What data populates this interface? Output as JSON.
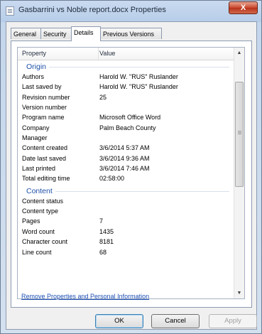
{
  "window": {
    "title": "Gasbarrini vs Noble report.docx Properties",
    "close_label": "X"
  },
  "tabs": [
    {
      "label": "General"
    },
    {
      "label": "Security"
    },
    {
      "label": "Details"
    },
    {
      "label": "Previous Versions"
    }
  ],
  "active_tab": "Details",
  "grid": {
    "header_property": "Property",
    "header_value": "Value",
    "groups": [
      {
        "label": "Origin",
        "rows": [
          {
            "property": "Authors",
            "value": "Harold W. \"RUS\" Ruslander"
          },
          {
            "property": "Last saved by",
            "value": "Harold W. \"RUS\" Ruslander"
          },
          {
            "property": "Revision number",
            "value": "25"
          },
          {
            "property": "Version number",
            "value": ""
          },
          {
            "property": "Program name",
            "value": "Microsoft Office Word"
          },
          {
            "property": "Company",
            "value": "Palm Beach County"
          },
          {
            "property": "Manager",
            "value": ""
          },
          {
            "property": "Content created",
            "value": "3/6/2014 5:37 AM"
          },
          {
            "property": "Date last saved",
            "value": "3/6/2014 9:36 AM"
          },
          {
            "property": "Last printed",
            "value": "3/6/2014 7:46 AM"
          },
          {
            "property": "Total editing time",
            "value": "02:58:00"
          }
        ]
      },
      {
        "label": "Content",
        "rows": [
          {
            "property": "Content status",
            "value": ""
          },
          {
            "property": "Content type",
            "value": ""
          },
          {
            "property": "Pages",
            "value": "7"
          },
          {
            "property": "Word count",
            "value": "1435"
          },
          {
            "property": "Character count",
            "value": "8181"
          },
          {
            "property": "Line count",
            "value": "68"
          }
        ]
      }
    ]
  },
  "scrollbar": {
    "up_arrow": "▲",
    "down_arrow": "▼"
  },
  "remove_link": "Remove Properties and Personal Information",
  "buttons": {
    "ok": "OK",
    "cancel": "Cancel",
    "apply": "Apply"
  }
}
